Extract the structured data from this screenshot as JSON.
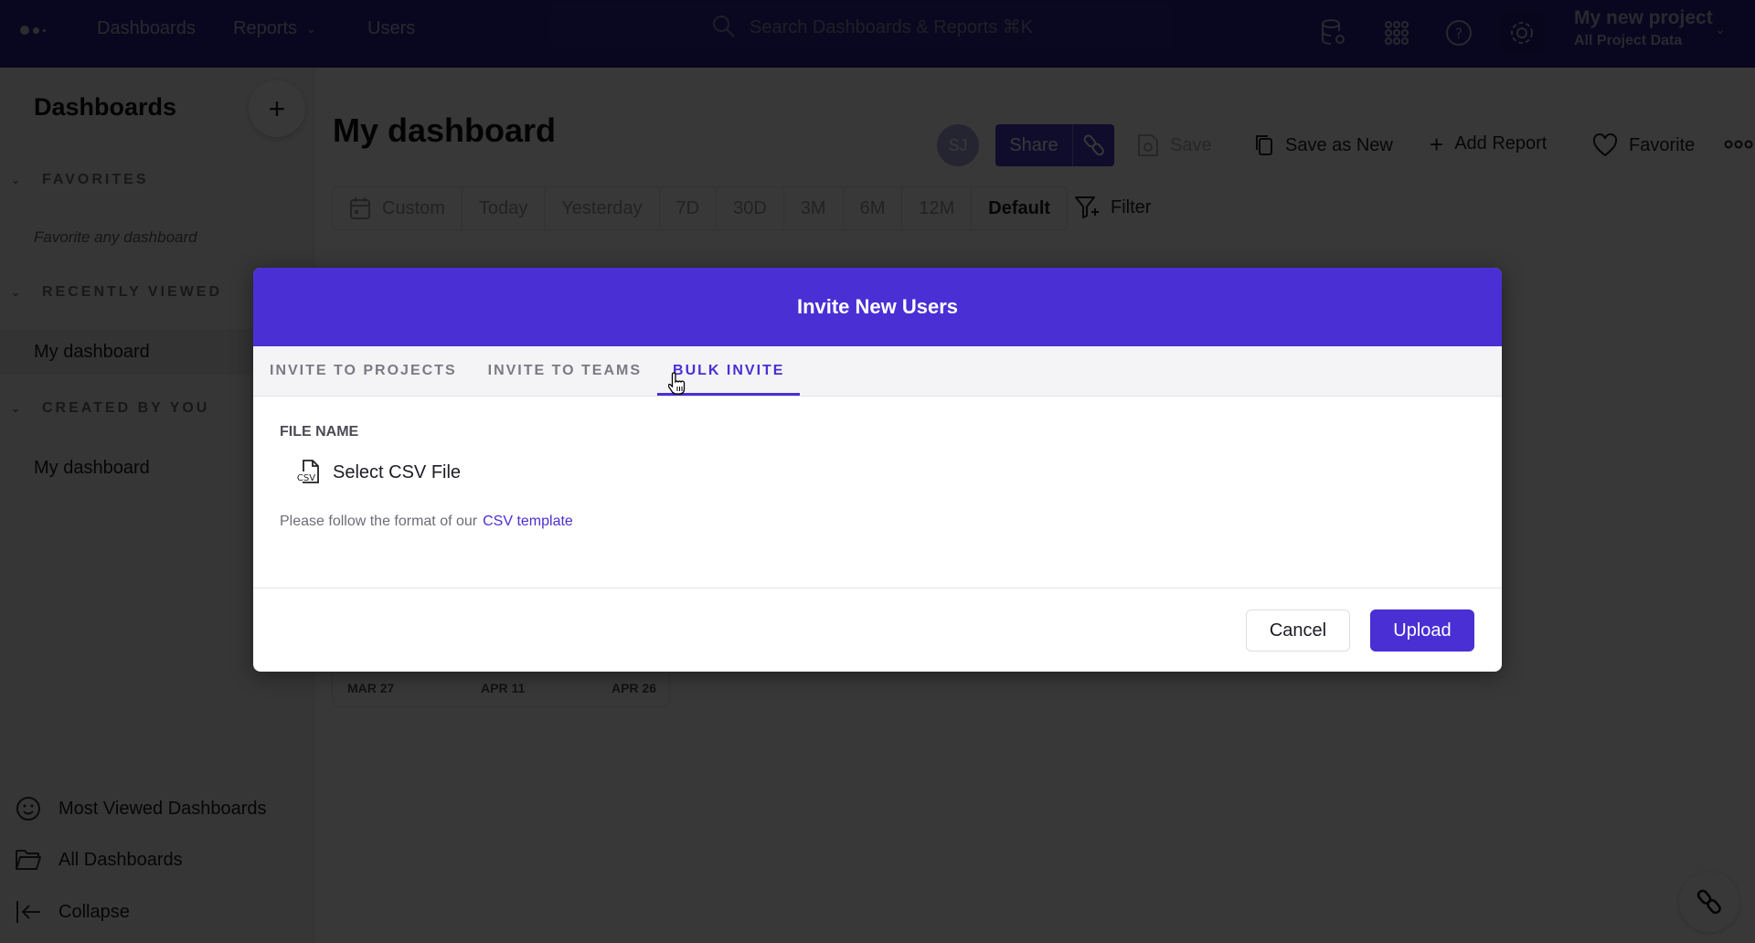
{
  "topbar": {
    "nav": [
      {
        "label": "Dashboards"
      },
      {
        "label": "Reports",
        "has_dropdown": true
      },
      {
        "label": "Users"
      }
    ],
    "search_placeholder": "Search Dashboards & Reports ⌘K",
    "icons": [
      "data-settings-icon",
      "apps-grid-icon",
      "help-icon",
      "settings-gear-icon"
    ],
    "project": {
      "name": "My new project",
      "scope": "All Project Data"
    }
  },
  "sidebar": {
    "title": "Dashboards",
    "add_label": "+",
    "sections": [
      {
        "label": "FAVORITES",
        "empty_text": "Favorite any dashboard",
        "items": []
      },
      {
        "label": "RECENTLY VIEWED",
        "items": [
          {
            "label": "My dashboard",
            "active": true
          }
        ]
      },
      {
        "label": "CREATED BY YOU",
        "items": [
          {
            "label": "My dashboard"
          }
        ]
      }
    ],
    "footer": [
      {
        "icon": "smiley-icon",
        "label": "Most Viewed Dashboards"
      },
      {
        "icon": "folder-icon",
        "label": "All Dashboards"
      },
      {
        "icon": "collapse-arrow-icon",
        "label": "Collapse"
      }
    ]
  },
  "main": {
    "title": "My dashboard",
    "avatar_initials": "SJ",
    "actions": {
      "share": "Share",
      "save": "Save",
      "save_as_new": "Save as New",
      "add_report": "Add Report",
      "favorite": "Favorite"
    },
    "date_range": {
      "options": [
        "Custom",
        "Today",
        "Yesterday",
        "7D",
        "30D",
        "3M",
        "6M",
        "12M",
        "Default"
      ],
      "selected": "Default"
    },
    "filter_label": "Filter",
    "chart_axis_labels": [
      "MAR 27",
      "APR 11",
      "APR 26"
    ]
  },
  "modal": {
    "title": "Invite New Users",
    "tabs": [
      {
        "label": "INVITE TO PROJECTS",
        "active": false
      },
      {
        "label": "INVITE TO TEAMS",
        "active": false
      },
      {
        "label": "BULK INVITE",
        "active": true
      }
    ],
    "file_label": "FILE NAME",
    "select_file": "Select CSV File",
    "hint_text": "Please follow the format of our",
    "hint_link": "CSV template",
    "cancel": "Cancel",
    "upload": "Upload"
  },
  "colors": {
    "brand": "#4a2fd4",
    "topbar": "#2b1f8f",
    "overlay": "rgba(0,0,0,0.78)"
  }
}
